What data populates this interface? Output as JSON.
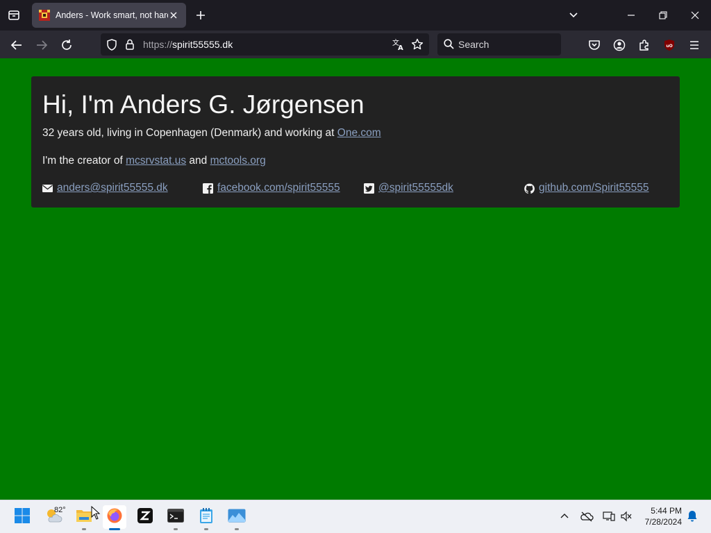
{
  "browser": {
    "tab": {
      "title": "Anders - Work smart, not hard"
    },
    "url": {
      "protocol": "https://",
      "host": "spirit55555.dk"
    },
    "search_placeholder": "Search"
  },
  "page": {
    "heading": "Hi, I'm Anders G. Jørgensen",
    "intro_text": "32 years old, living in Copenhagen (Denmark) and working at ",
    "employer_link": "One.com",
    "creator_prefix": "I'm the creator of ",
    "project1_link": "mcsrvstat.us",
    "creator_and": " and ",
    "project2_link": "mctools.org",
    "contacts": {
      "email": "anders@spirit55555.dk",
      "facebook": "facebook.com/spirit55555",
      "twitter": "@spirit55555dk",
      "github": "github.com/Spirit55555"
    },
    "background_color": "#007b00"
  },
  "taskbar": {
    "weather_temp": "82°",
    "time": "5:44 PM",
    "date": "7/28/2024"
  }
}
